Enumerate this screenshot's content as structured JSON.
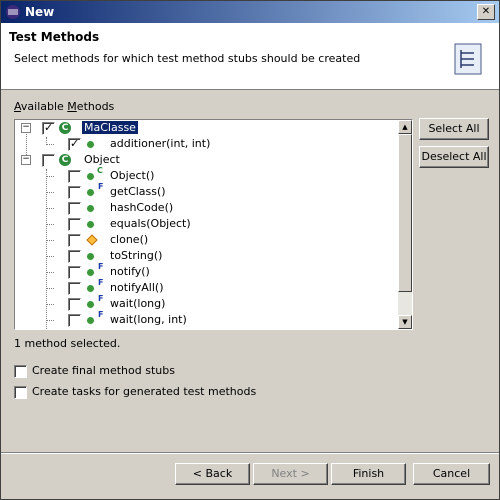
{
  "window": {
    "title": "New"
  },
  "header": {
    "title": "Test Methods",
    "description": "Select methods for which test method stubs should be created"
  },
  "available_methods_label": "Available Methods",
  "tree": {
    "nodes": [
      {
        "label": "MaClasse",
        "checked": true,
        "kind": "class",
        "selected": true
      },
      {
        "label": "additioner(int, int)",
        "checked": true,
        "kind": "method"
      },
      {
        "label": "Object",
        "checked": false,
        "kind": "class"
      },
      {
        "label": "Object()",
        "checked": false,
        "kind": "constructor"
      },
      {
        "label": "getClass()",
        "checked": false,
        "kind": "final-method"
      },
      {
        "label": "hashCode()",
        "checked": false,
        "kind": "method"
      },
      {
        "label": "equals(Object)",
        "checked": false,
        "kind": "method"
      },
      {
        "label": "clone()",
        "checked": false,
        "kind": "protected-method"
      },
      {
        "label": "toString()",
        "checked": false,
        "kind": "method"
      },
      {
        "label": "notify()",
        "checked": false,
        "kind": "final-method"
      },
      {
        "label": "notifyAll()",
        "checked": false,
        "kind": "final-method"
      },
      {
        "label": "wait(long)",
        "checked": false,
        "kind": "final-method"
      },
      {
        "label": "wait(long, int)",
        "checked": false,
        "kind": "final-method"
      }
    ]
  },
  "buttons": {
    "select_all": "Select All",
    "deselect_all": "Deselect All",
    "back": "< Back",
    "next": "Next >",
    "finish": "Finish",
    "cancel": "Cancel"
  },
  "status": "1 method selected.",
  "options": {
    "final_stubs": {
      "label": "Create final method stubs",
      "checked": false
    },
    "tasks": {
      "label": "Create tasks for generated test methods",
      "checked": false
    }
  },
  "icons": {
    "final_marker": "F",
    "constructor_marker": "C",
    "class_marker": "C"
  },
  "colors": {
    "title_bar_start": "#0a246a",
    "title_bar_end": "#a6caf0",
    "dialog_bg": "#d4d0c8",
    "selection": "#0a246a"
  }
}
